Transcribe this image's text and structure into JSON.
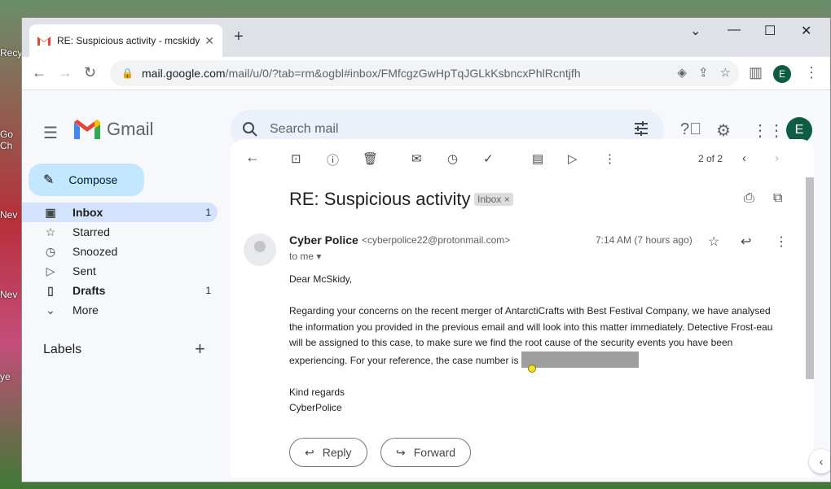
{
  "browser": {
    "tab_title": "RE: Suspicious activity - mcskidy",
    "url_host": "mail.google.com",
    "url_path": "/mail/u/0/?tab=rm&ogbl#inbox/FMfcgzGwHpTqJGLkKsbncxPhlRcntjfh",
    "profile_initial": "E"
  },
  "desktop": {
    "icons": [
      "Recy",
      "Go",
      "Ch",
      "Nev",
      "Nev",
      "ye"
    ]
  },
  "gmail": {
    "logo_text": "Gmail",
    "search_placeholder": "Search mail",
    "account_initial": "E",
    "compose_label": "Compose",
    "nav": [
      {
        "label": "Inbox",
        "count": "1",
        "icon": "inbox-icon"
      },
      {
        "label": "Starred",
        "count": "",
        "icon": "star-icon"
      },
      {
        "label": "Snoozed",
        "count": "",
        "icon": "clock-icon"
      },
      {
        "label": "Sent",
        "count": "",
        "icon": "send-icon"
      },
      {
        "label": "Drafts",
        "count": "1",
        "icon": "file-icon"
      },
      {
        "label": "More",
        "count": "",
        "icon": "chevron-down-icon"
      }
    ],
    "labels_heading": "Labels",
    "pager": "2 of 2"
  },
  "email": {
    "subject": "RE: Suspicious activity",
    "badge": "Inbox",
    "sender_name": "Cyber Police",
    "sender_email": "<cyberpolice22@protonmail.com>",
    "to": "to me",
    "time": "7:14 AM (7 hours ago)",
    "greeting": "Dear McSkidy,",
    "paragraph": "Regarding your concerns on the recent merger of AntarctiCrafts with Best Festival Company, we have analysed the information you provided in the previous email and will look into this matter immediately. Detective Frost-eau will be assigned to this case, to make sure we find the root cause of the security events you have been experiencing. For your reference, the case number is",
    "signoff_1": "Kind regards",
    "signoff_2": "CyberPolice",
    "reply_label": "Reply",
    "forward_label": "Forward"
  },
  "colors": {
    "accent": "#0b57d0",
    "compose_bg": "#c2e7ff",
    "active_nav": "#d3e3fd",
    "avatar_bg": "#0d5c43"
  }
}
